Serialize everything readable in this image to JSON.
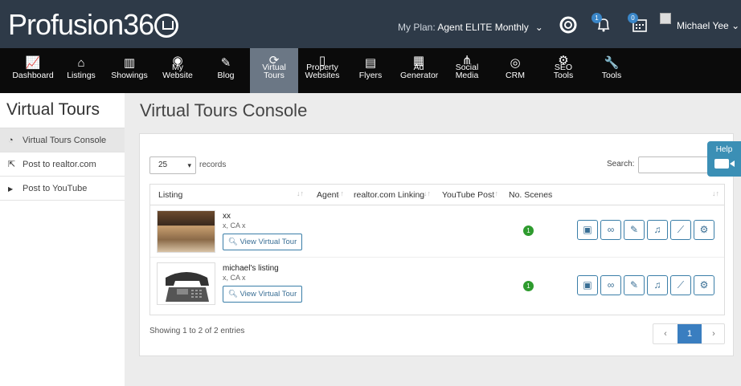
{
  "header": {
    "logo_text": "Profusion36",
    "plan_prefix": "My Plan:",
    "plan_name": "Agent ELITE Monthly",
    "notification_count": "1",
    "calendar_count": "0",
    "user_name": "Michael Yee"
  },
  "nav": {
    "items": [
      {
        "label": "Dashboard",
        "icon": "chart-line-icon"
      },
      {
        "label": "Listings",
        "icon": "home-icon"
      },
      {
        "label": "Showings",
        "icon": "bar-chart-icon"
      },
      {
        "label": "My Website",
        "icon": "globe-icon"
      },
      {
        "label": "Blog",
        "icon": "edit-icon"
      },
      {
        "label": "Virtual Tours",
        "icon": "refresh-icon",
        "active": true
      },
      {
        "label": "Property Websites",
        "icon": "tablet-icon"
      },
      {
        "label": "Flyers",
        "icon": "file-icon"
      },
      {
        "label": "Ad Generator",
        "icon": "newspaper-icon"
      },
      {
        "label": "Social Media",
        "icon": "share-icon"
      },
      {
        "label": "CRM",
        "icon": "target-icon"
      },
      {
        "label": "SEO Tools",
        "icon": "gear-icon"
      },
      {
        "label": "Tools",
        "icon": "wrench-icon"
      }
    ]
  },
  "sidebar": {
    "title": "Virtual Tours",
    "items": [
      {
        "label": "Virtual Tours Console",
        "icon": "dashboard-icon",
        "active": true
      },
      {
        "label": "Post to realtor.com",
        "icon": "external-link-icon"
      },
      {
        "label": "Post to YouTube",
        "icon": "youtube-icon"
      }
    ]
  },
  "main": {
    "title": "Virtual Tours Console",
    "records_value": "25",
    "records_label": "records",
    "search_label": "Search:",
    "columns": [
      "Listing",
      "Agent",
      "realtor.com Linking",
      "YouTube Post",
      "No. Scenes"
    ],
    "rows": [
      {
        "title": "xx",
        "address": "x, CA x",
        "button": "View Virtual Tour",
        "scenes": "1"
      },
      {
        "title": "michael's listing",
        "address": "x, CA x",
        "button": "View Virtual Tour",
        "scenes": "1"
      }
    ],
    "info": "Showing 1 to 2 of 2 entries",
    "pager": {
      "prev": "‹",
      "current": "1",
      "next": "›"
    }
  },
  "help": {
    "label": "Help"
  }
}
